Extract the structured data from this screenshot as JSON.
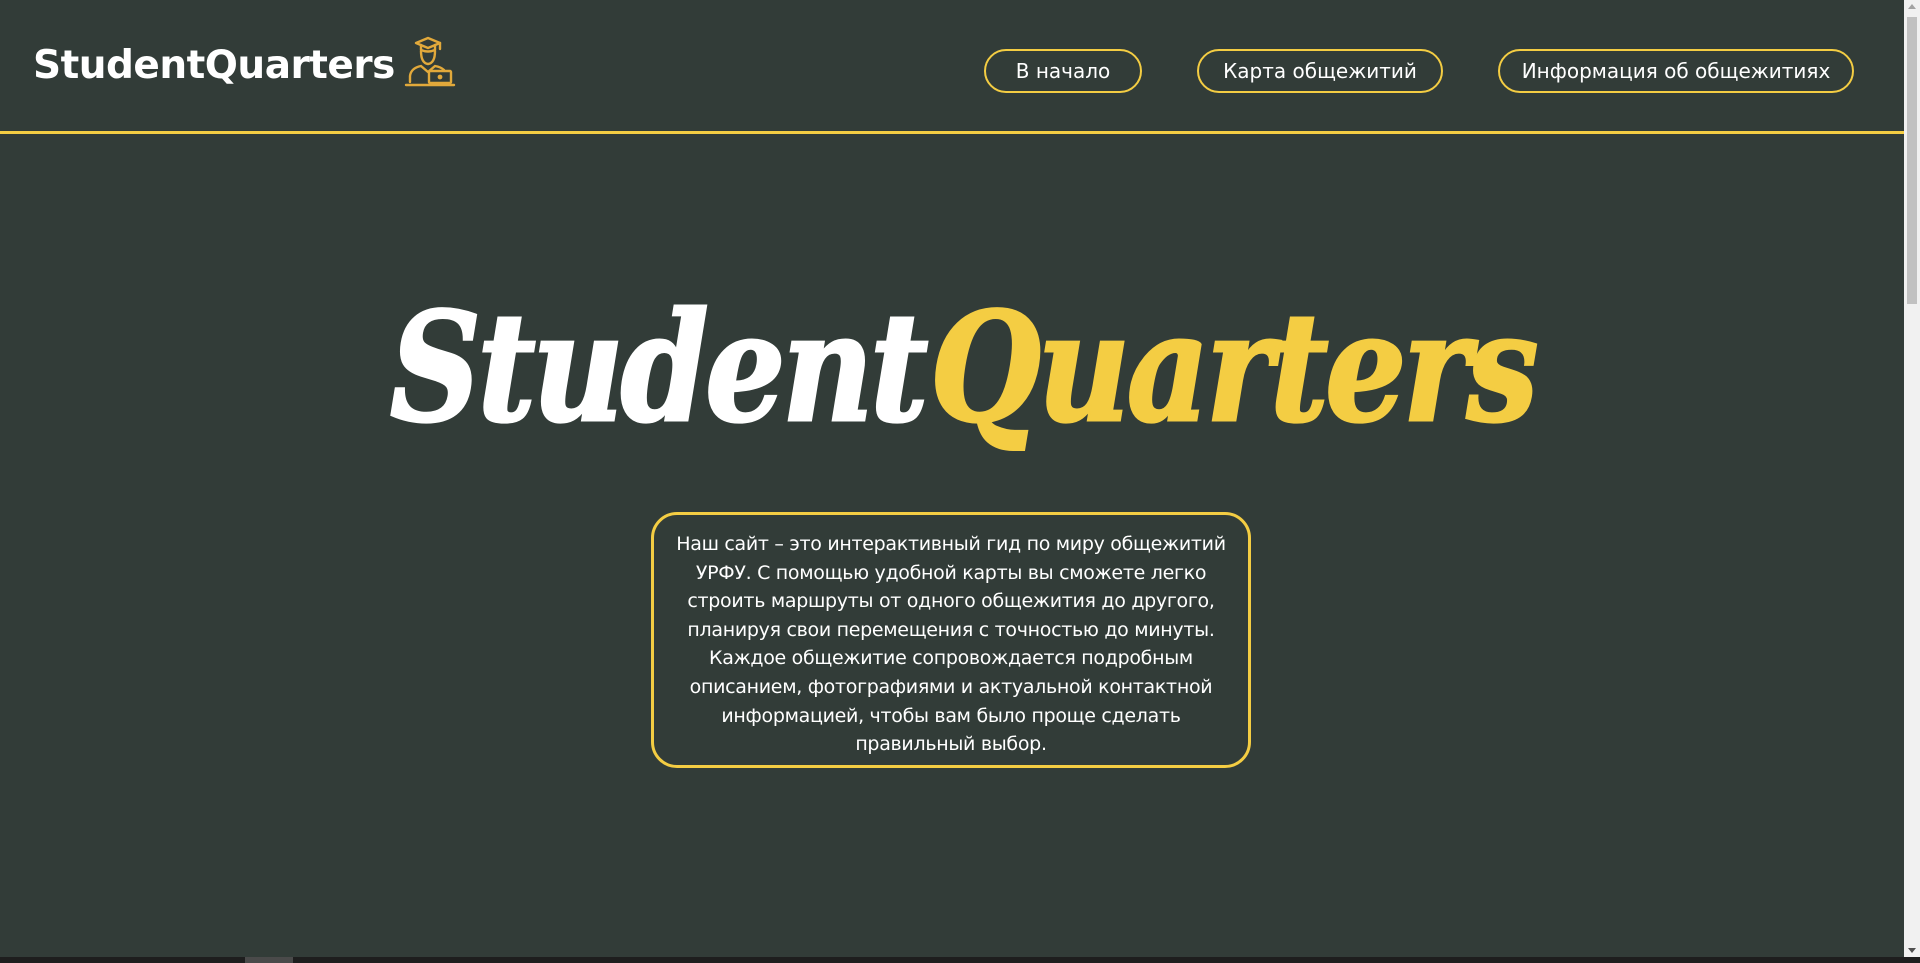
{
  "header": {
    "brand": "StudentQuarters",
    "brand_icon": "graduate-laptop-icon",
    "nav": [
      {
        "label": "В начало"
      },
      {
        "label": "Карта общежитий"
      },
      {
        "label": "Информация об общежитиях"
      }
    ]
  },
  "hero": {
    "title_part1": "Student",
    "title_part2": "Quarters"
  },
  "description": {
    "lines": [
      "Наш сайт – это интерактивный гид по миру общежитий",
      "УРФУ. С помощью удобной карты вы сможете легко",
      "строить маршруты от одного общежития до другого,",
      "планируя свои перемещения с точностью до минуты.",
      "Каждое общежитие сопровождается подробным",
      "описанием, фотографиями и актуальной контактной",
      "информацией, чтобы вам было проще сделать",
      "правильный выбор."
    ]
  },
  "colors": {
    "background": "#323c38",
    "accent": "#f4cd43",
    "text": "#ffffff"
  }
}
